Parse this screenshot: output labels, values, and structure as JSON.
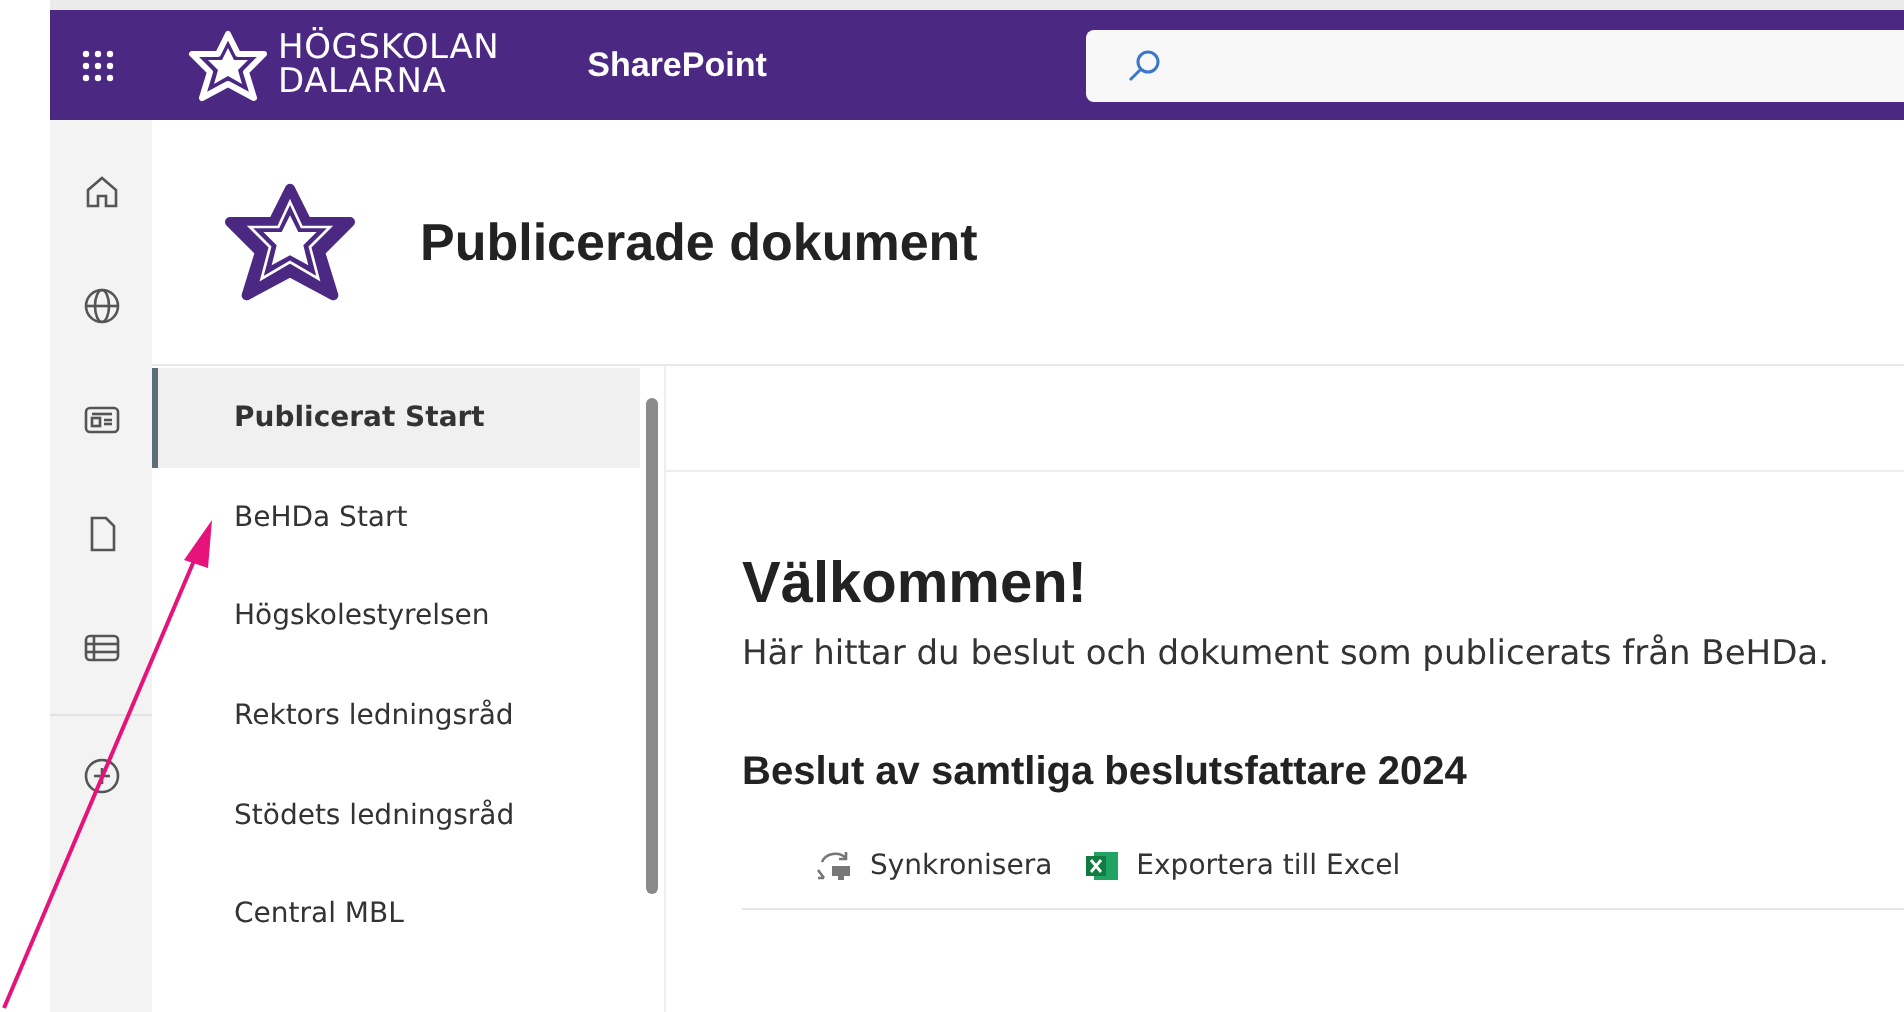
{
  "suite_bar": {
    "logo_line_1": "HÖGSKOLAN",
    "logo_line_2": "DALARNA",
    "app_name": "SharePoint"
  },
  "app_bar": {
    "items": [
      {
        "kind": "home"
      },
      {
        "kind": "globe"
      },
      {
        "kind": "news"
      },
      {
        "kind": "file"
      },
      {
        "kind": "list"
      },
      {
        "kind": "add"
      }
    ]
  },
  "site_header": {
    "title": "Publicerade dokument"
  },
  "navigation": {
    "items": [
      {
        "label": "Publicerat Start",
        "selected": true
      },
      {
        "label": "BeHDa Start",
        "selected": false
      },
      {
        "label": "Högskolestyrelsen",
        "selected": false
      },
      {
        "label": "Rektors ledningsråd",
        "selected": false
      },
      {
        "label": "Stödets ledningsråd",
        "selected": false
      },
      {
        "label": "Central MBL",
        "selected": false
      }
    ]
  },
  "content": {
    "heading": "Välkommen!",
    "intro": "Här hittar du beslut och dokument som publicerats från BeHDa.",
    "list_title": "Beslut av samtliga beslutsfattare 2024",
    "commands": [
      {
        "kind": "sync",
        "label": "Synkronisera"
      },
      {
        "kind": "excel",
        "label": "Exportera till Excel"
      }
    ]
  }
}
